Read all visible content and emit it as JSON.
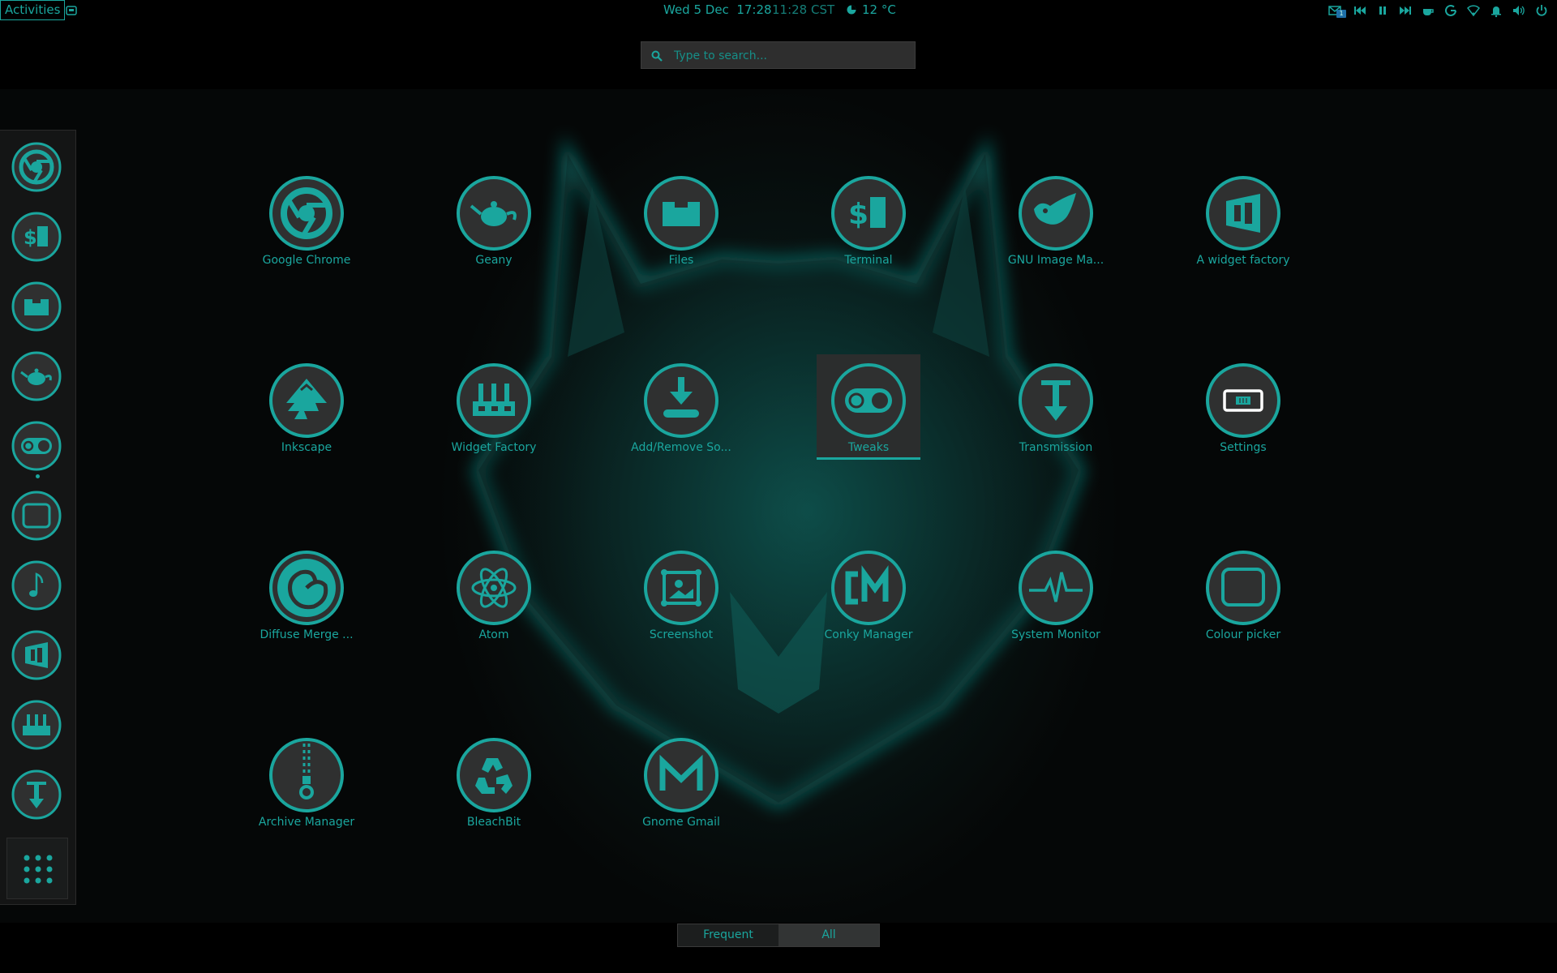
{
  "topbar": {
    "activities": "Activities",
    "date_time": "Wed 5 Dec  17:28",
    "second_clock": "11:28 CST",
    "weather": "12 °C",
    "mail_count": "1"
  },
  "search": {
    "placeholder": "Type to search..."
  },
  "colors": {
    "accent": "#1aa69e",
    "background": "#000000",
    "icon_bg": "#2f3030"
  },
  "dash": {
    "items": [
      {
        "name": "google-chrome",
        "icon": "chrome-icon"
      },
      {
        "name": "terminal",
        "icon": "terminal-icon"
      },
      {
        "name": "files",
        "icon": "files-icon"
      },
      {
        "name": "geany",
        "icon": "teapot-icon"
      },
      {
        "name": "tweaks",
        "icon": "tweaks-icon"
      },
      {
        "name": "colour-picker",
        "icon": "rounded-square-icon"
      },
      {
        "name": "music",
        "icon": "music-note-icon"
      },
      {
        "name": "widget-factory",
        "icon": "widget-factory-icon"
      },
      {
        "name": "factory",
        "icon": "factory-icon"
      },
      {
        "name": "transmission",
        "icon": "transmission-icon"
      }
    ]
  },
  "apps": [
    {
      "label": "Google Chrome",
      "icon": "chrome-icon"
    },
    {
      "label": "Geany",
      "icon": "teapot-icon"
    },
    {
      "label": "Files",
      "icon": "files-icon"
    },
    {
      "label": "Terminal",
      "icon": "terminal-icon"
    },
    {
      "label": "GNU Image Ma...",
      "icon": "gimp-icon"
    },
    {
      "label": "A widget factory",
      "icon": "widget-factory-icon"
    },
    {
      "label": "Inkscape",
      "icon": "inkscape-icon"
    },
    {
      "label": "Widget Factory",
      "icon": "factory-icon"
    },
    {
      "label": "Add/Remove So...",
      "icon": "download-icon"
    },
    {
      "label": "Tweaks",
      "icon": "tweaks-icon"
    },
    {
      "label": "Transmission",
      "icon": "transmission-icon"
    },
    {
      "label": "Settings",
      "icon": "settings-icon"
    },
    {
      "label": "Diffuse Merge ...",
      "icon": "swirl-icon"
    },
    {
      "label": "Atom",
      "icon": "atom-icon"
    },
    {
      "label": "Screenshot",
      "icon": "screenshot-icon"
    },
    {
      "label": "Conky Manager",
      "icon": "conky-icon"
    },
    {
      "label": "System Monitor",
      "icon": "pulse-icon"
    },
    {
      "label": "Colour picker",
      "icon": "rounded-square-icon"
    },
    {
      "label": "Archive Manager",
      "icon": "zipper-icon"
    },
    {
      "label": "BleachBit",
      "icon": "recycle-icon"
    },
    {
      "label": "Gnome Gmail",
      "icon": "gmail-icon"
    }
  ],
  "selected_app": "Tweaks",
  "view_switch": {
    "frequent": "Frequent",
    "all": "All",
    "active": "All"
  }
}
